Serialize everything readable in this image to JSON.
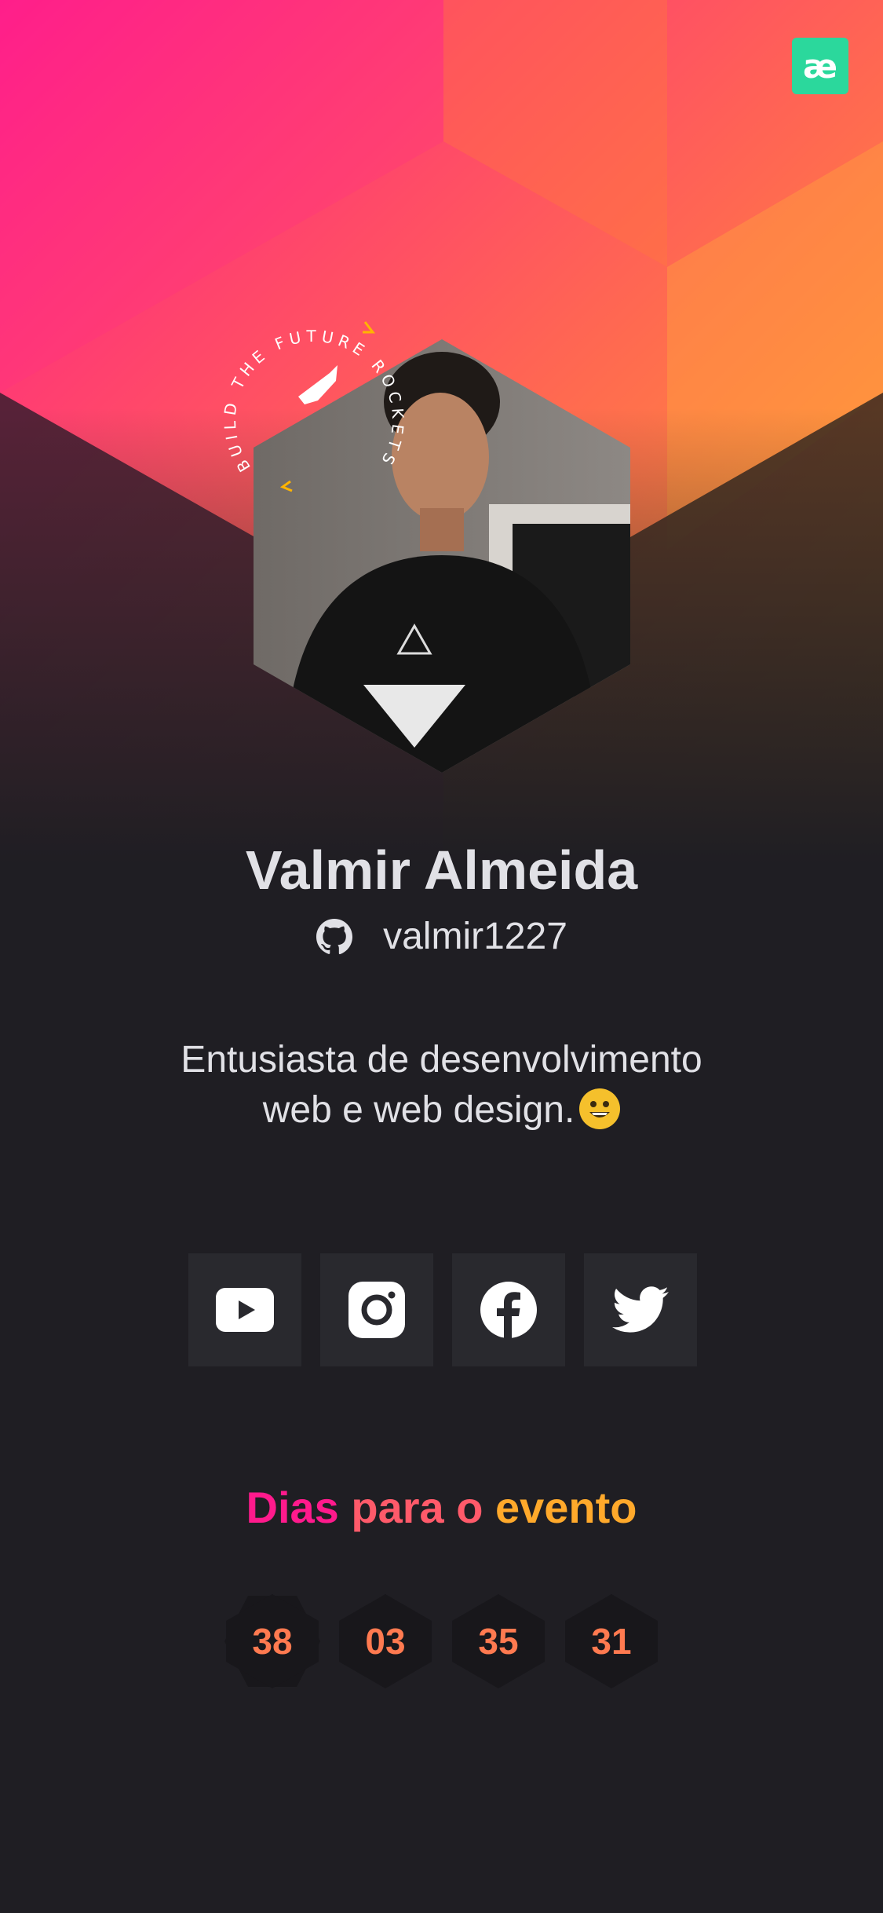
{
  "brand": {
    "logo_text": "æ",
    "accent": "#2bd89c"
  },
  "badge": {
    "ring_text": "BUILD THE FUTURE  ROCKETSEAT"
  },
  "profile": {
    "name": "Valmir Almeida",
    "github_user": "valmir1227",
    "bio_line1": "Entusiasta de desenvolvimento",
    "bio_line2": "web e web design."
  },
  "socials": [
    {
      "icon": "youtube-icon"
    },
    {
      "icon": "instagram-icon"
    },
    {
      "icon": "facebook-icon"
    },
    {
      "icon": "twitter-icon"
    }
  ],
  "countdown": {
    "title_part1": "Dias ",
    "title_part2": "para o ",
    "title_part3": "evento",
    "values": [
      "38",
      "03",
      "35",
      "31"
    ]
  },
  "colors": {
    "background": "#1f1e23",
    "card": "#29292e",
    "text": "#e1e1e6",
    "pink": "#ff008e",
    "orange": "#ffa92b"
  }
}
